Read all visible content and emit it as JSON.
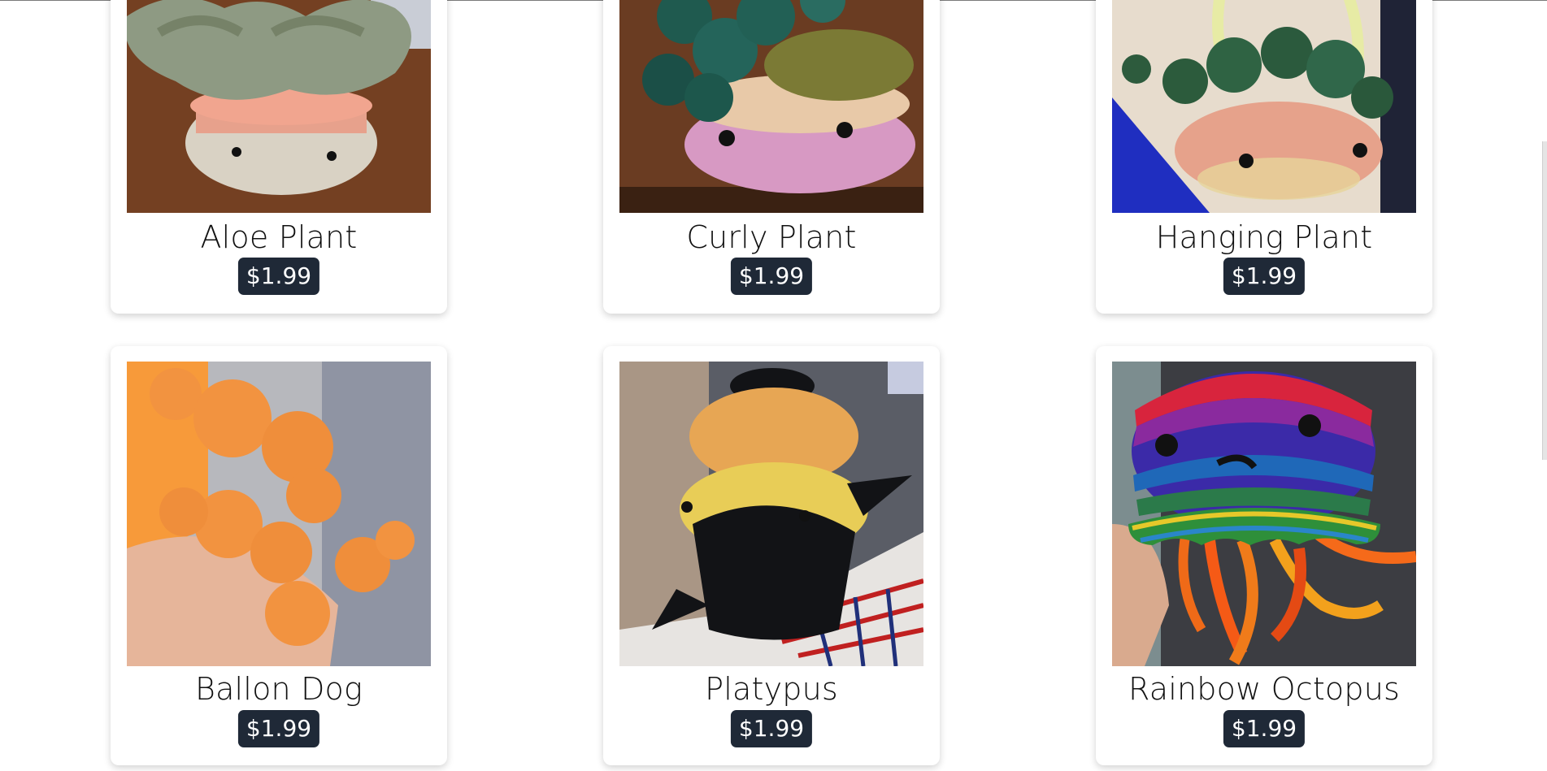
{
  "products": [
    {
      "name": "Aloe Plant",
      "price": "$1.99",
      "image": "aloe-plant-photo"
    },
    {
      "name": "Curly Plant",
      "price": "$1.99",
      "image": "curly-plant-photo"
    },
    {
      "name": "Hanging Plant",
      "price": "$1.99",
      "image": "hanging-plant-photo"
    },
    {
      "name": "Ballon Dog",
      "price": "$1.99",
      "image": "balloon-dog-photo"
    },
    {
      "name": "Platypus",
      "price": "$1.99",
      "image": "platypus-photo"
    },
    {
      "name": "Rainbow Octopus",
      "price": "$1.99",
      "image": "rainbow-octopus-photo"
    }
  ],
  "colors": {
    "price_badge_bg": "#1f2937",
    "price_badge_text": "#ffffff",
    "card_bg": "#ffffff"
  }
}
